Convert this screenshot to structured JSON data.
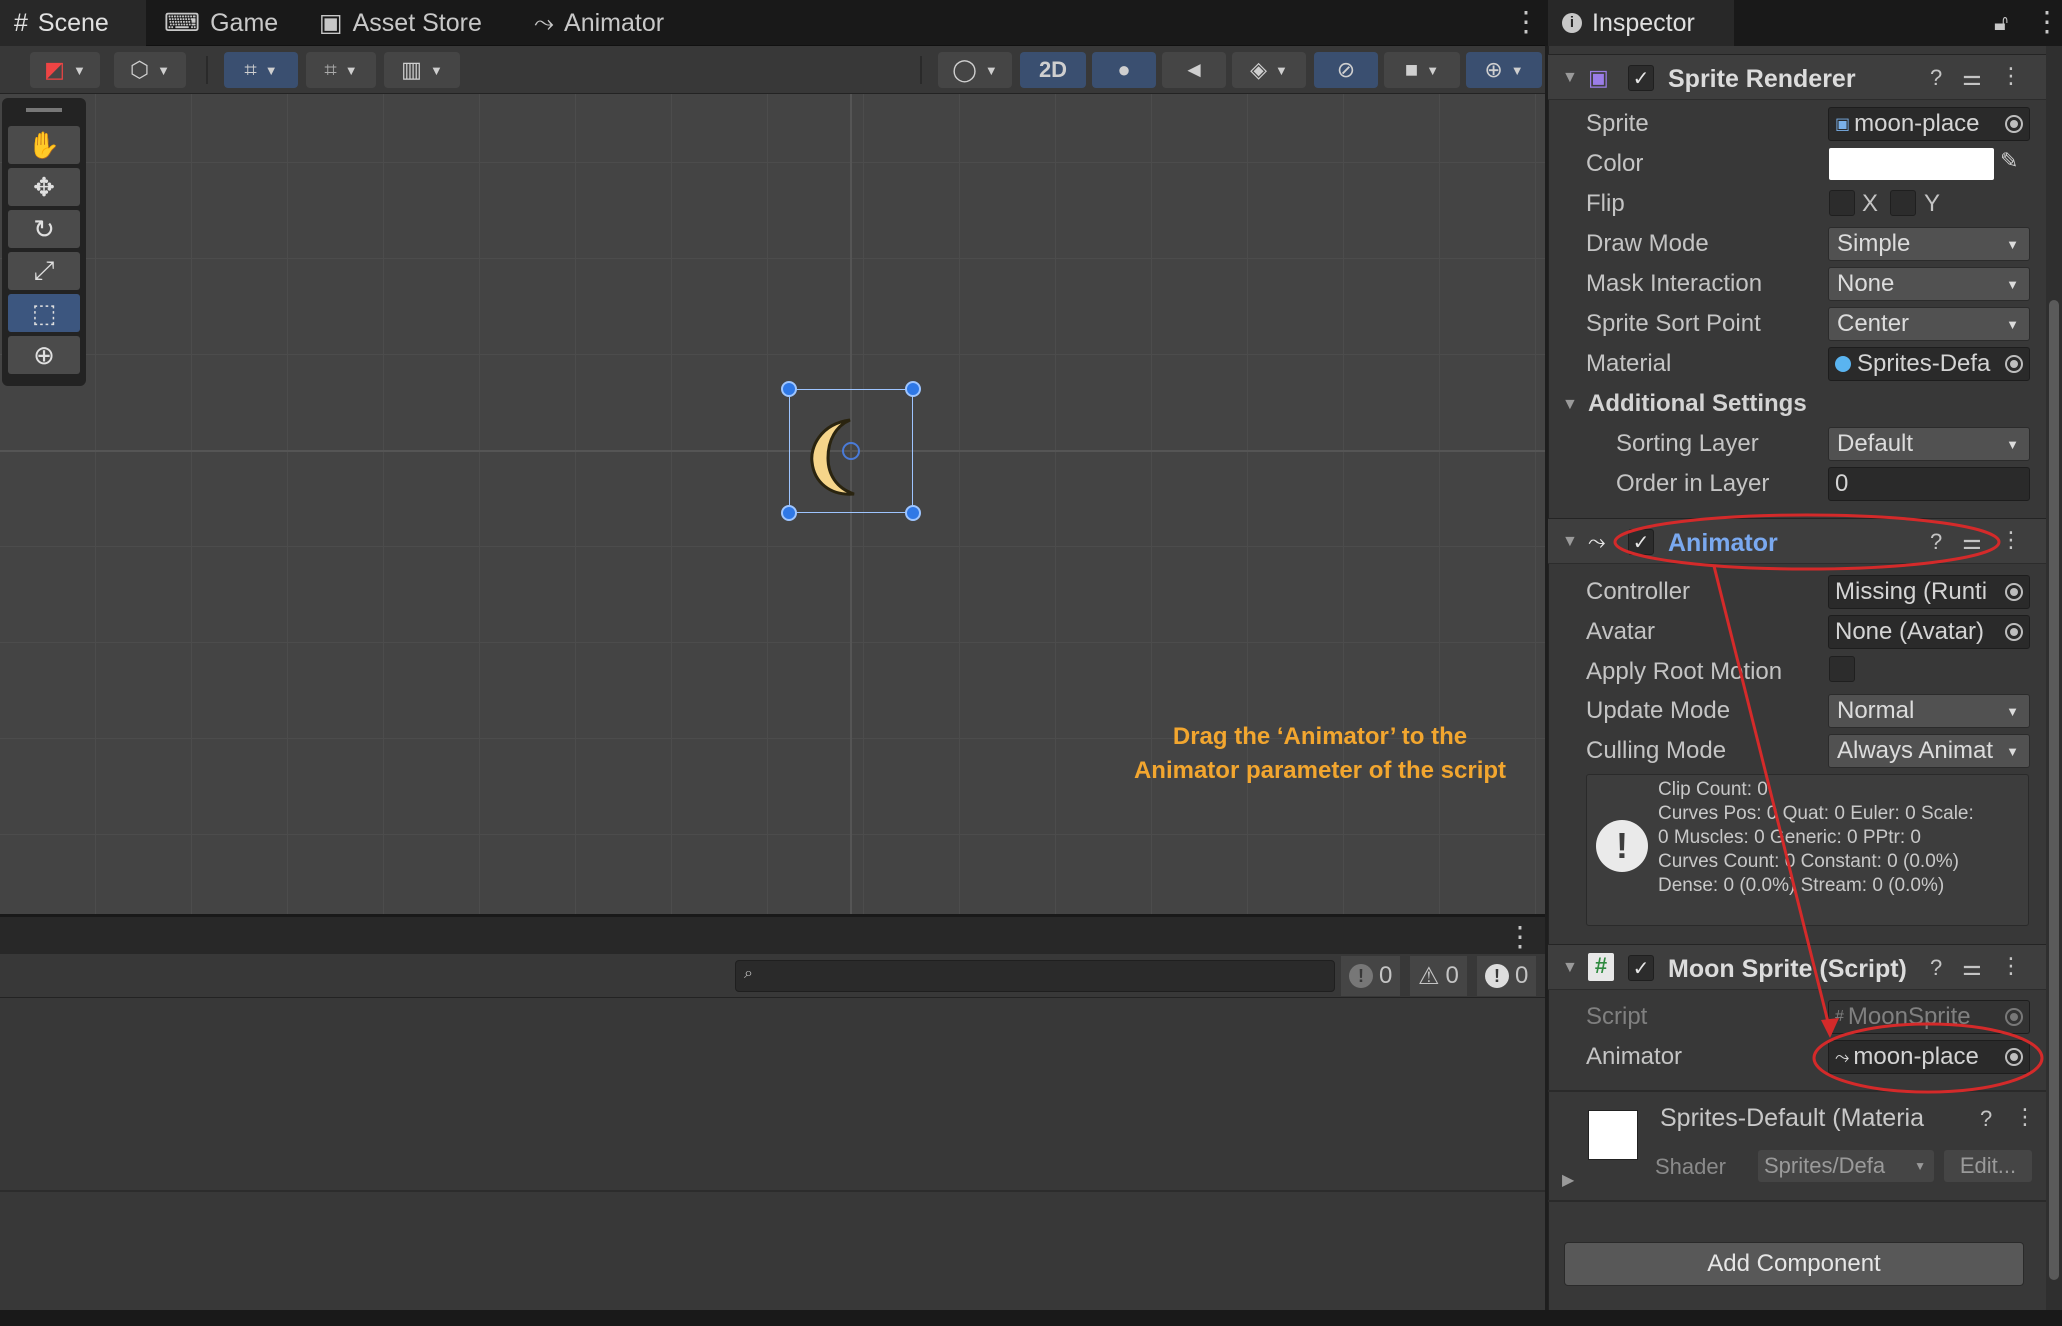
{
  "tabs": [
    {
      "label": "Scene",
      "icon": "grid-icon"
    },
    {
      "label": "Game",
      "icon": "gamepad-icon"
    },
    {
      "label": "Asset Store",
      "icon": "store-icon"
    },
    {
      "label": "Animator",
      "icon": "animator-icon"
    }
  ],
  "toolbar": {
    "mode_2d": "2D"
  },
  "console": {
    "error_count": "0",
    "warning_count": "0",
    "message_count": "0"
  },
  "inspector": {
    "tab_label": "Inspector",
    "sprite_renderer": {
      "title": "Sprite Renderer",
      "fields": {
        "sprite_label": "Sprite",
        "sprite_value": "moon-place",
        "color_label": "Color",
        "flip_label": "Flip",
        "flip_x": "X",
        "flip_y": "Y",
        "draw_mode_label": "Draw Mode",
        "draw_mode_value": "Simple",
        "mask_label": "Mask Interaction",
        "mask_value": "None",
        "sort_point_label": "Sprite Sort Point",
        "sort_point_value": "Center",
        "material_label": "Material",
        "material_value": "Sprites-Defa"
      },
      "additional_settings": "Additional Settings",
      "sorting_layer_label": "Sorting Layer",
      "sorting_layer_value": "Default",
      "order_label": "Order in Layer",
      "order_value": "0"
    },
    "animator": {
      "title": "Animator",
      "controller_label": "Controller",
      "controller_value": "Missing (Runti",
      "avatar_label": "Avatar",
      "avatar_value": "None (Avatar)",
      "root_motion_label": "Apply Root Motion",
      "update_mode_label": "Update Mode",
      "update_mode_value": "Normal",
      "culling_label": "Culling Mode",
      "culling_value": "Always Animat",
      "info_text": "Clip Count: 0\nCurves Pos: 0 Quat: 0 Euler: 0 Scale:\n0 Muscles: 0 Generic: 0 PPtr: 0\nCurves Count: 0 Constant: 0 (0.0%)\nDense: 0 (0.0%) Stream: 0 (0.0%)"
    },
    "moon_sprite": {
      "title": "Moon Sprite (Script)",
      "script_label": "Script",
      "script_value": "MoonSprite",
      "animator_label": "Animator",
      "animator_value": "moon-place"
    },
    "material": {
      "title": "Sprites-Default (Materia",
      "shader_label": "Shader",
      "shader_value": "Sprites/Defa",
      "edit_label": "Edit..."
    },
    "add_component": "Add Component"
  },
  "annotation": {
    "note": "Drag the ‘Animator’ to the Animator parameter of the script",
    "color": "#f2a62f",
    "arrow_color": "#d42a2a"
  }
}
